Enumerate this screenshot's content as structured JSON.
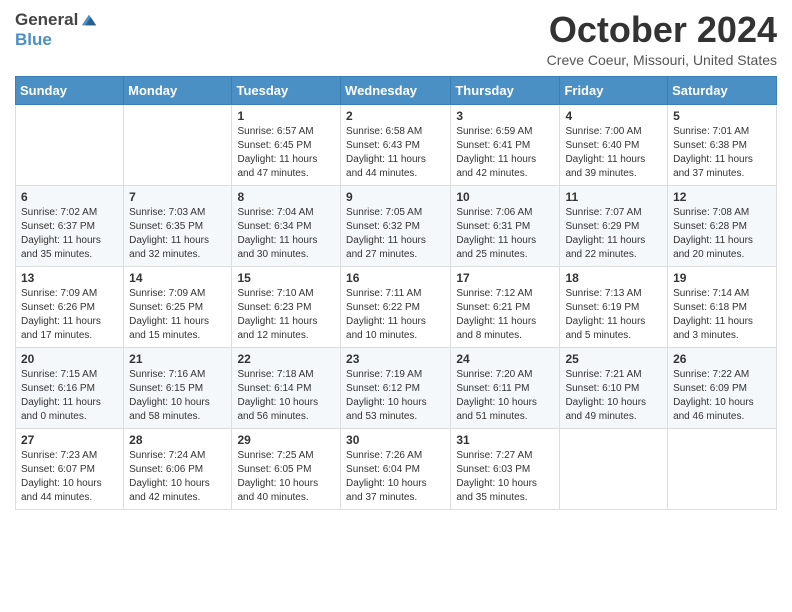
{
  "header": {
    "logo_general": "General",
    "logo_blue": "Blue",
    "month": "October 2024",
    "location": "Creve Coeur, Missouri, United States"
  },
  "weekdays": [
    "Sunday",
    "Monday",
    "Tuesday",
    "Wednesday",
    "Thursday",
    "Friday",
    "Saturday"
  ],
  "weeks": [
    [
      {
        "day": "",
        "info": ""
      },
      {
        "day": "",
        "info": ""
      },
      {
        "day": "1",
        "info": "Sunrise: 6:57 AM\nSunset: 6:45 PM\nDaylight: 11 hours and 47 minutes."
      },
      {
        "day": "2",
        "info": "Sunrise: 6:58 AM\nSunset: 6:43 PM\nDaylight: 11 hours and 44 minutes."
      },
      {
        "day": "3",
        "info": "Sunrise: 6:59 AM\nSunset: 6:41 PM\nDaylight: 11 hours and 42 minutes."
      },
      {
        "day": "4",
        "info": "Sunrise: 7:00 AM\nSunset: 6:40 PM\nDaylight: 11 hours and 39 minutes."
      },
      {
        "day": "5",
        "info": "Sunrise: 7:01 AM\nSunset: 6:38 PM\nDaylight: 11 hours and 37 minutes."
      }
    ],
    [
      {
        "day": "6",
        "info": "Sunrise: 7:02 AM\nSunset: 6:37 PM\nDaylight: 11 hours and 35 minutes."
      },
      {
        "day": "7",
        "info": "Sunrise: 7:03 AM\nSunset: 6:35 PM\nDaylight: 11 hours and 32 minutes."
      },
      {
        "day": "8",
        "info": "Sunrise: 7:04 AM\nSunset: 6:34 PM\nDaylight: 11 hours and 30 minutes."
      },
      {
        "day": "9",
        "info": "Sunrise: 7:05 AM\nSunset: 6:32 PM\nDaylight: 11 hours and 27 minutes."
      },
      {
        "day": "10",
        "info": "Sunrise: 7:06 AM\nSunset: 6:31 PM\nDaylight: 11 hours and 25 minutes."
      },
      {
        "day": "11",
        "info": "Sunrise: 7:07 AM\nSunset: 6:29 PM\nDaylight: 11 hours and 22 minutes."
      },
      {
        "day": "12",
        "info": "Sunrise: 7:08 AM\nSunset: 6:28 PM\nDaylight: 11 hours and 20 minutes."
      }
    ],
    [
      {
        "day": "13",
        "info": "Sunrise: 7:09 AM\nSunset: 6:26 PM\nDaylight: 11 hours and 17 minutes."
      },
      {
        "day": "14",
        "info": "Sunrise: 7:09 AM\nSunset: 6:25 PM\nDaylight: 11 hours and 15 minutes."
      },
      {
        "day": "15",
        "info": "Sunrise: 7:10 AM\nSunset: 6:23 PM\nDaylight: 11 hours and 12 minutes."
      },
      {
        "day": "16",
        "info": "Sunrise: 7:11 AM\nSunset: 6:22 PM\nDaylight: 11 hours and 10 minutes."
      },
      {
        "day": "17",
        "info": "Sunrise: 7:12 AM\nSunset: 6:21 PM\nDaylight: 11 hours and 8 minutes."
      },
      {
        "day": "18",
        "info": "Sunrise: 7:13 AM\nSunset: 6:19 PM\nDaylight: 11 hours and 5 minutes."
      },
      {
        "day": "19",
        "info": "Sunrise: 7:14 AM\nSunset: 6:18 PM\nDaylight: 11 hours and 3 minutes."
      }
    ],
    [
      {
        "day": "20",
        "info": "Sunrise: 7:15 AM\nSunset: 6:16 PM\nDaylight: 11 hours and 0 minutes."
      },
      {
        "day": "21",
        "info": "Sunrise: 7:16 AM\nSunset: 6:15 PM\nDaylight: 10 hours and 58 minutes."
      },
      {
        "day": "22",
        "info": "Sunrise: 7:18 AM\nSunset: 6:14 PM\nDaylight: 10 hours and 56 minutes."
      },
      {
        "day": "23",
        "info": "Sunrise: 7:19 AM\nSunset: 6:12 PM\nDaylight: 10 hours and 53 minutes."
      },
      {
        "day": "24",
        "info": "Sunrise: 7:20 AM\nSunset: 6:11 PM\nDaylight: 10 hours and 51 minutes."
      },
      {
        "day": "25",
        "info": "Sunrise: 7:21 AM\nSunset: 6:10 PM\nDaylight: 10 hours and 49 minutes."
      },
      {
        "day": "26",
        "info": "Sunrise: 7:22 AM\nSunset: 6:09 PM\nDaylight: 10 hours and 46 minutes."
      }
    ],
    [
      {
        "day": "27",
        "info": "Sunrise: 7:23 AM\nSunset: 6:07 PM\nDaylight: 10 hours and 44 minutes."
      },
      {
        "day": "28",
        "info": "Sunrise: 7:24 AM\nSunset: 6:06 PM\nDaylight: 10 hours and 42 minutes."
      },
      {
        "day": "29",
        "info": "Sunrise: 7:25 AM\nSunset: 6:05 PM\nDaylight: 10 hours and 40 minutes."
      },
      {
        "day": "30",
        "info": "Sunrise: 7:26 AM\nSunset: 6:04 PM\nDaylight: 10 hours and 37 minutes."
      },
      {
        "day": "31",
        "info": "Sunrise: 7:27 AM\nSunset: 6:03 PM\nDaylight: 10 hours and 35 minutes."
      },
      {
        "day": "",
        "info": ""
      },
      {
        "day": "",
        "info": ""
      }
    ]
  ]
}
